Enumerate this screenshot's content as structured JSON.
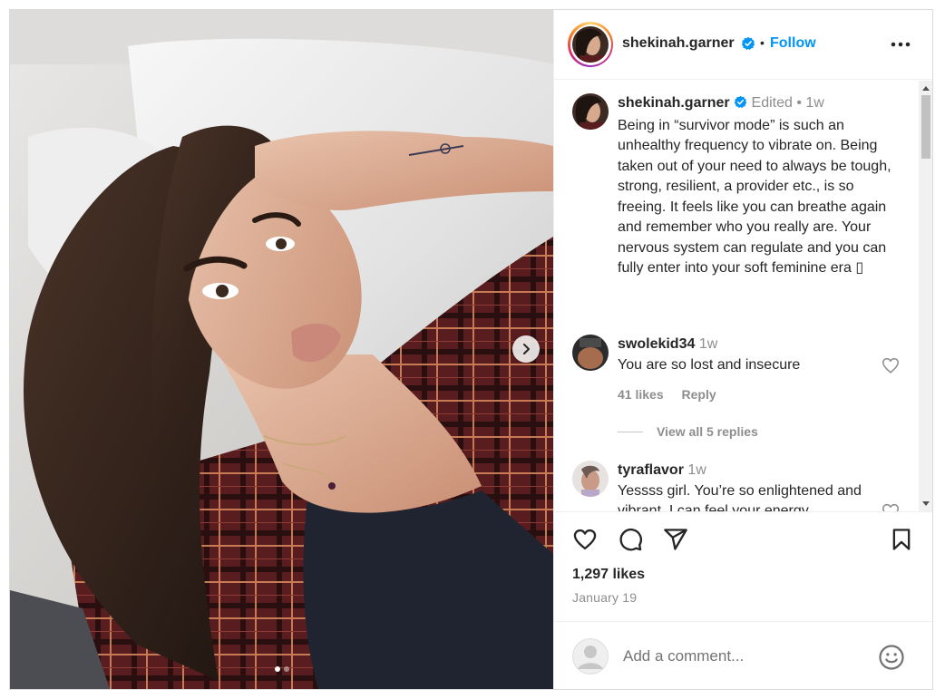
{
  "post": {
    "username": "shekinah.garner",
    "follow_label": "Follow",
    "separator": "•",
    "caption": {
      "username": "shekinah.garner",
      "edited_label": "Edited",
      "separator": "•",
      "time": "1w",
      "text": "Being in “survivor mode” is such an unhealthy frequency to vibrate on. Being taken out of your need to always be tough, strong, resilient, a provider etc., is so freeing. It feels like you can breathe again and remember who you really are. Your nervous system can regulate and you can fully enter into your soft feminine era ▯"
    },
    "comments": [
      {
        "username": "swolekid34",
        "time": "1w",
        "text": "You are so lost and insecure",
        "likes": "41 likes",
        "reply_label": "Reply",
        "view_replies": "View all 5 replies"
      },
      {
        "username": "tyraflavor",
        "time": "1w",
        "text": "Yessss girl. You’re so enlightened and vibrant. I can feel your energy"
      }
    ],
    "likes_count": "1,297 likes",
    "date": "January 19",
    "add_comment_placeholder": "Add a comment...",
    "carousel": {
      "total_slides": 2,
      "current_slide": 1
    }
  },
  "colors": {
    "link_blue": "#0095f6",
    "verified_blue": "#0095f6",
    "text": "#262626",
    "muted": "#8e8e8e"
  },
  "icons": {
    "header_more": "more-horizontal-icon",
    "verified": "verified-badge-icon",
    "comment_like": "heart-outline-icon",
    "like": "heart-outline-icon",
    "comment": "speech-bubble-icon",
    "share": "paper-plane-icon",
    "save": "bookmark-icon",
    "emoji": "smiley-icon",
    "carousel_next": "chevron-right-icon"
  }
}
